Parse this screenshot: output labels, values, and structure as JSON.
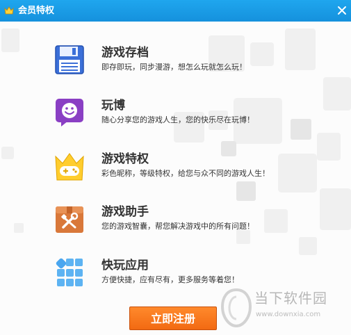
{
  "window": {
    "title": "会员特权",
    "title_icon": "crown-icon",
    "close_icon": "close-icon"
  },
  "features": [
    {
      "icon": "save-disk-icon",
      "name": "游戏存档",
      "desc": "即存即玩，同步漫游，想怎么玩就怎么玩！"
    },
    {
      "icon": "smiley-chat-icon",
      "name": "玩博",
      "desc": "随心分享您的游戏人生，您的快乐尽在玩博！"
    },
    {
      "icon": "crown-gamepad-icon",
      "name": "游戏特权",
      "desc": "彩色昵称，等级特权，给您与众不同的游戏人生！"
    },
    {
      "icon": "toolbox-icon",
      "name": "游戏助手",
      "desc": "您的游戏智囊，帮您解决游戏中的所有问题！"
    },
    {
      "icon": "app-grid-icon",
      "name": "快玩应用",
      "desc": "方便快捷，应有尽有，更多服务等着您！"
    }
  ],
  "register_label": "立即注册",
  "watermark": {
    "brand": "当下软件园",
    "url": "www.downxia.com"
  },
  "colors": {
    "titlebar": "#1a9be6",
    "button": "#f47a1f",
    "text": "#333333"
  }
}
